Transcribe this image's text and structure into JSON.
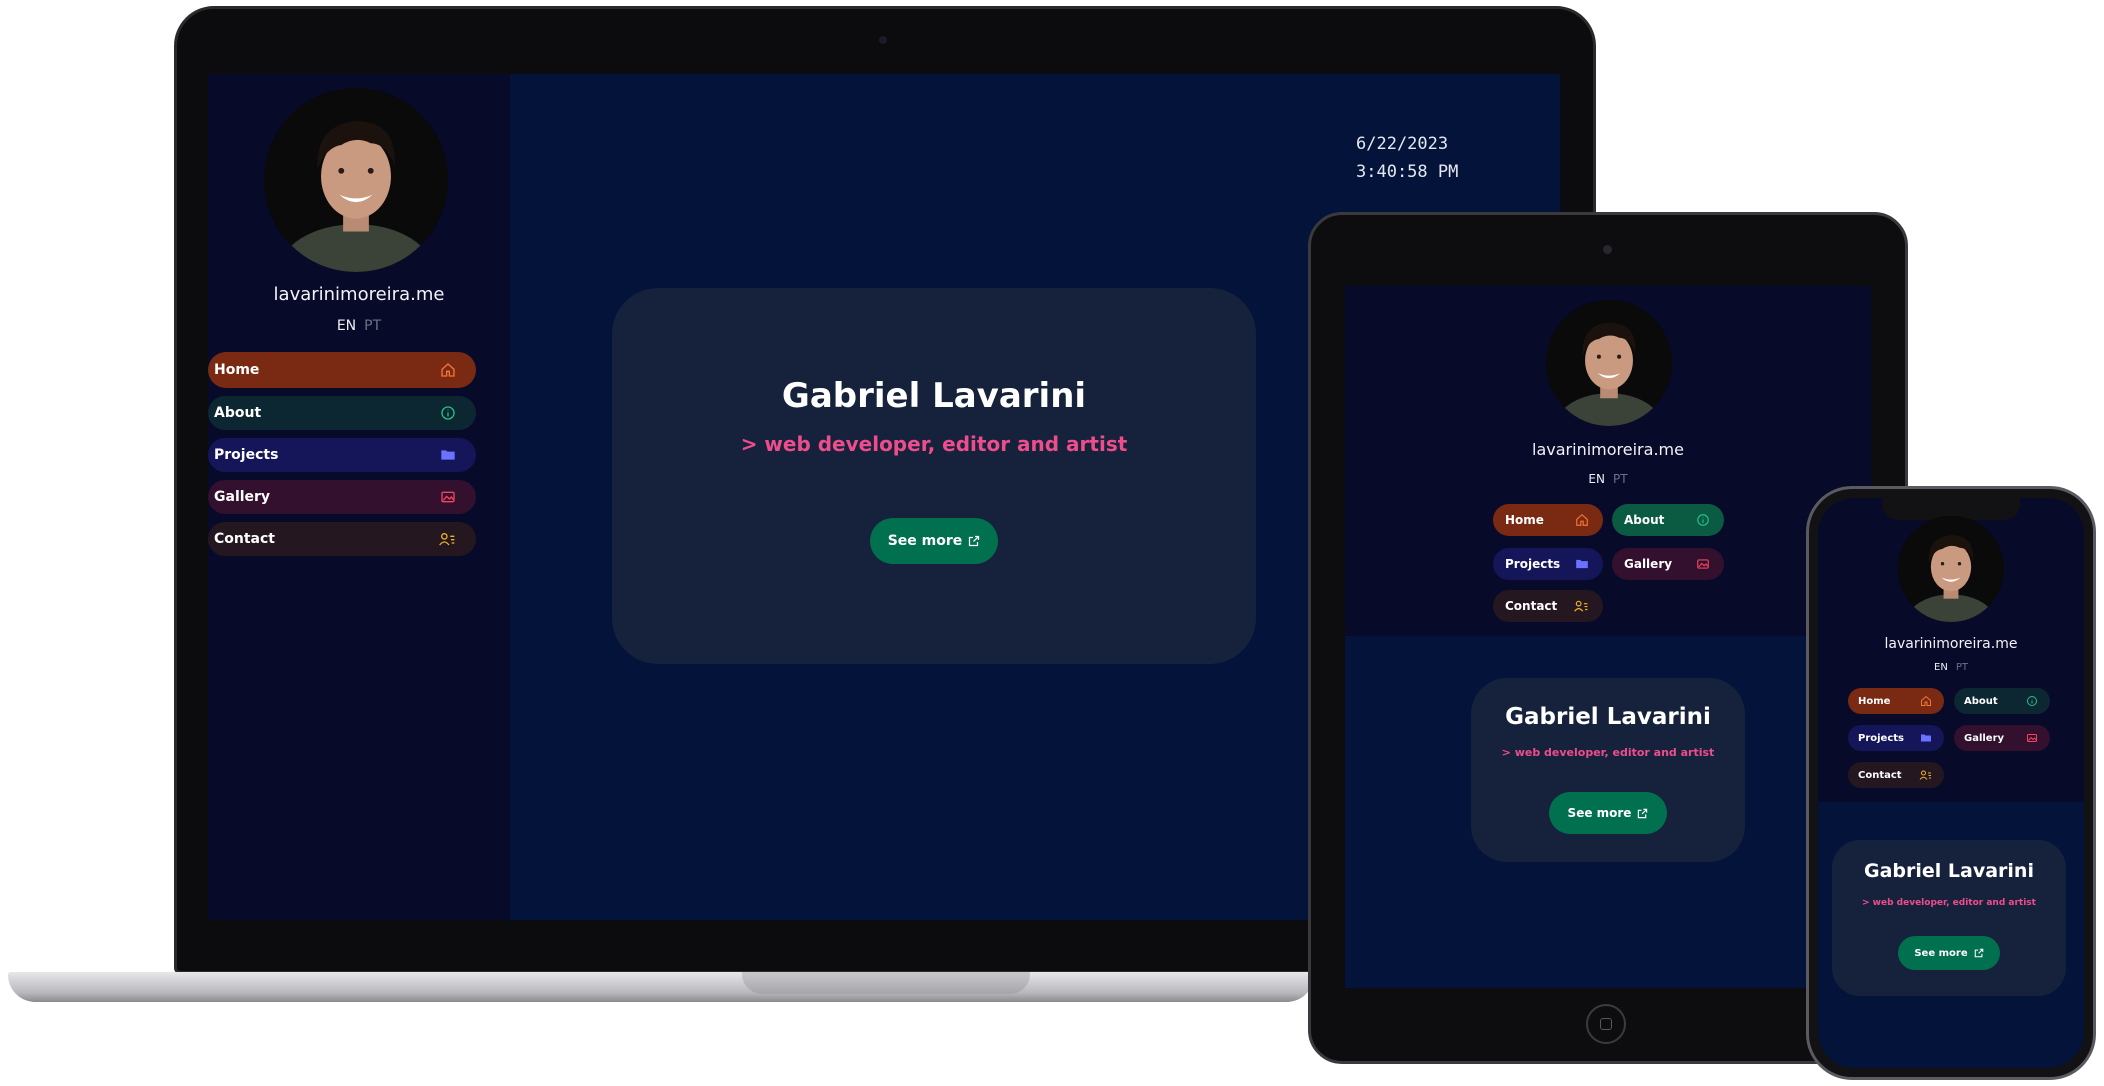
{
  "site": {
    "domain": "lavarinimoreira.me",
    "lang_en": "EN",
    "lang_pt": "PT",
    "nav": [
      {
        "key": "home",
        "label": "Home",
        "icon": "home-icon",
        "icon_color": "#f0763a"
      },
      {
        "key": "about",
        "label": "About",
        "icon": "info-icon",
        "icon_color": "#25c089"
      },
      {
        "key": "projects",
        "label": "Projects",
        "icon": "folder-icon",
        "icon_color": "#6b72ff"
      },
      {
        "key": "gallery",
        "label": "Gallery",
        "icon": "image-icon",
        "icon_color": "#f2445e"
      },
      {
        "key": "contact",
        "label": "Contact",
        "icon": "user-list-icon",
        "icon_color": "#f0b429"
      }
    ],
    "hero": {
      "name": "Gabriel Lavarini",
      "role": "> web developer, editor and artist",
      "cta": "See more",
      "cta_icon": "external-link-icon"
    },
    "clock": {
      "date": "6/22/2023",
      "time": "3:40:58 PM"
    }
  },
  "colors": {
    "page_bg": "#03133a",
    "sidebar_bg": "#080a2a",
    "card_bg": "#16223b",
    "accent_pink": "#ee4d8c",
    "cta_green": "#00704f",
    "home_active": "#7a2a12"
  },
  "devices": [
    "laptop",
    "tablet",
    "phone"
  ]
}
